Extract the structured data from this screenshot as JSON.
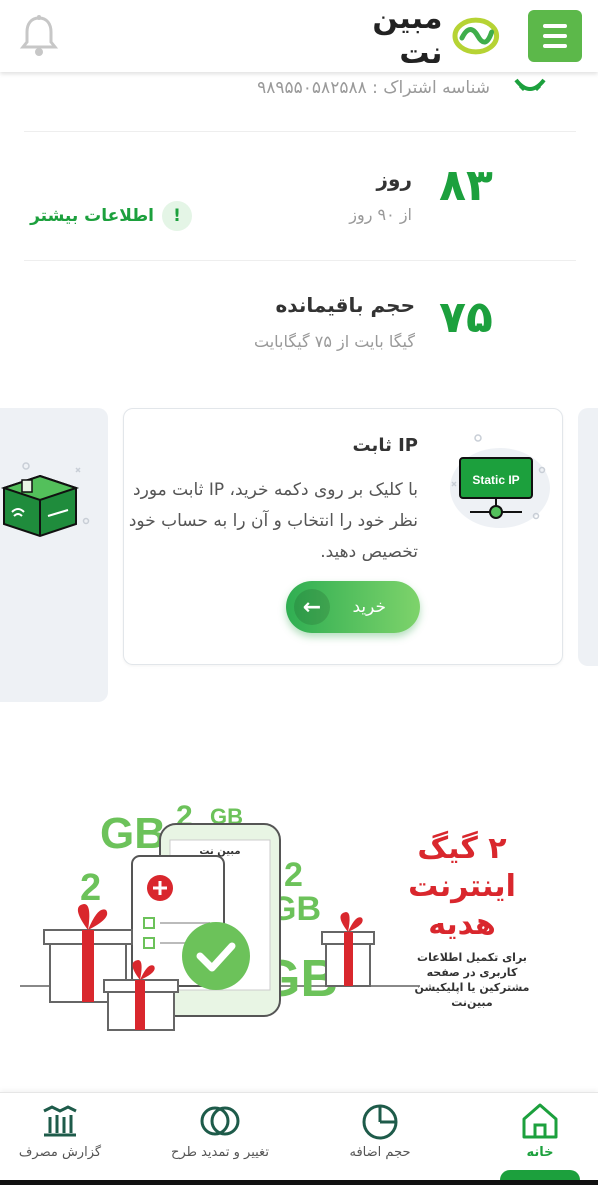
{
  "header": {
    "brand_name": "مبین نت",
    "menu_icon": "hamburger-menu-icon",
    "notification_icon": "bell-icon"
  },
  "subscription": {
    "label_text": "شناسه اشتراک : ۹۸۹۵۵۰۵۸۲۵۸۸"
  },
  "days": {
    "value": "۸۳",
    "title": "روز",
    "subtitle": "از ۹۰ روز",
    "more_badge": "!",
    "more_label": "اطلاعات بیشتر"
  },
  "volume": {
    "value": "۷۵",
    "title": "حجم باقیمانده",
    "subtitle": "گیگا بایت از ۷۵ گیگابایت"
  },
  "card": {
    "title": "IP ثابت",
    "description": "با کلیک بر روی دکمه خرید، IP ثابت مورد نظر خود را انتخاب و آن را به حساب خود تخصیص دهید.",
    "illustration_label": "Static IP",
    "buy_label": "خرید"
  },
  "promo": {
    "title_line1": "۲ گیگ",
    "title_line2": "اینترنت",
    "title_line3": "هدیه",
    "subtitle": "برای تکمیل اطلاعات کاربری در صفحه مشترکین یا اپلیکیشن مبین‌نت",
    "gb_text": "GB",
    "mini_brand": "مبین نت"
  },
  "bottom_nav": {
    "items": [
      {
        "label": "خانه",
        "icon": "home-icon"
      },
      {
        "label": "حجم اضافه",
        "icon": "pie-chart-icon"
      },
      {
        "label": "تغییر و تمدید طرح",
        "icon": "overlap-circles-icon"
      },
      {
        "label": "گزارش مصرف",
        "icon": "bar-chart-icon"
      }
    ]
  },
  "colors": {
    "brand_green": "#1ca03d",
    "menu_green": "#5cb84a",
    "promo_red": "#d9272d"
  }
}
